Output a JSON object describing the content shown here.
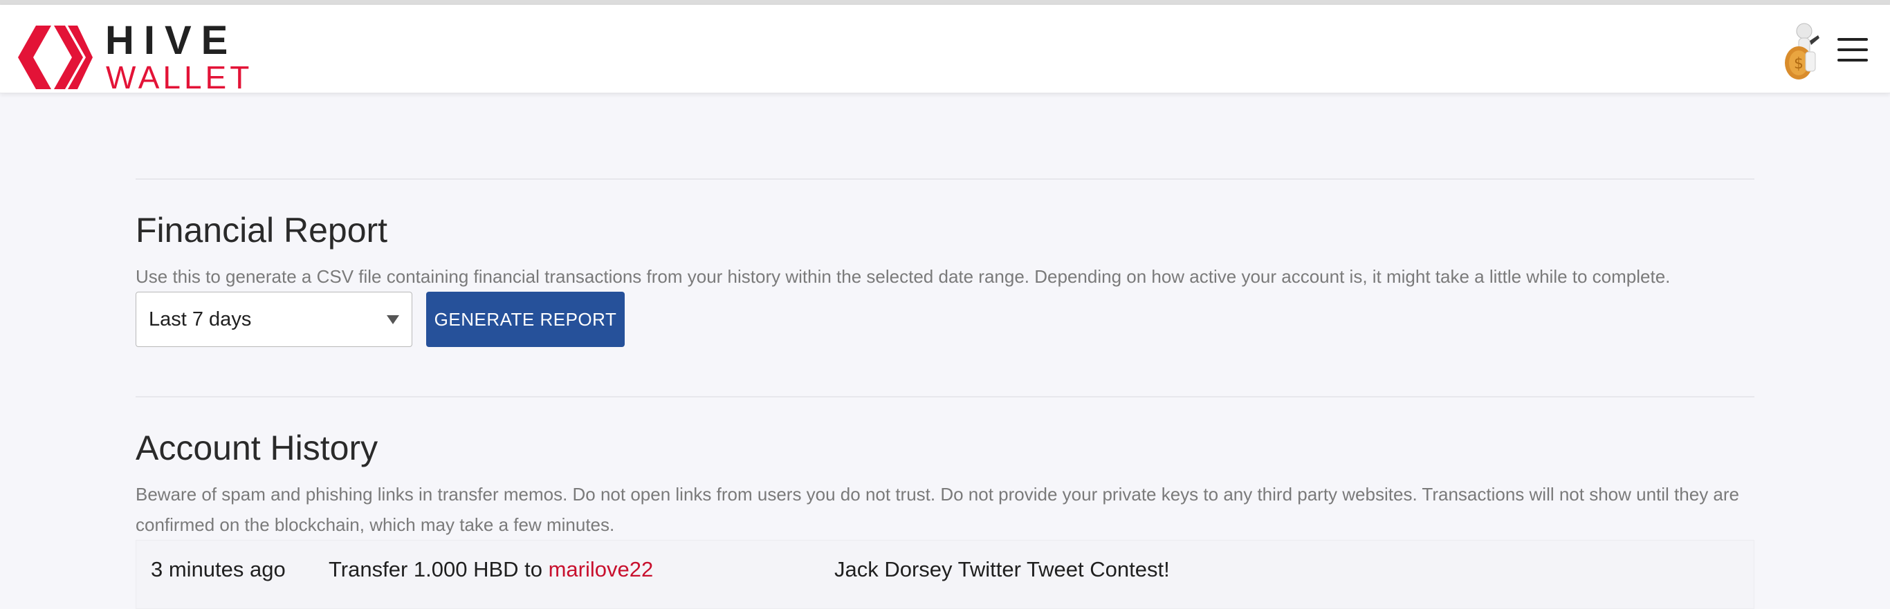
{
  "header": {
    "logo_top": "HIVE",
    "logo_bottom": "WALLET",
    "brand_color": "#e31337"
  },
  "financial_report": {
    "title": "Financial Report",
    "description": "Use this to generate a CSV file containing financial transactions from your history within the selected date range. Depending on how active your account is, it might take a little while to complete.",
    "range_select_value": "Last 7 days",
    "button_label": "GENERATE REPORT",
    "button_color": "#26519a"
  },
  "account_history": {
    "title": "Account History",
    "description": "Beware of spam and phishing links in transfer memos. Do not open links from users you do not trust. Do not provide your private keys to any third party websites. Transactions will not show until they are confirmed on the blockchain, which may take a few minutes.",
    "rows": [
      {
        "time": "3 minutes ago",
        "op_prefix": "Transfer 1.000 HBD to ",
        "op_user": "marilove22",
        "memo": "Jack Dorsey Twitter Tweet Contest!"
      }
    ]
  },
  "icons": {
    "logo": "hive-logo-icon",
    "avatar": "user-avatar",
    "menu": "hamburger-menu-icon"
  }
}
